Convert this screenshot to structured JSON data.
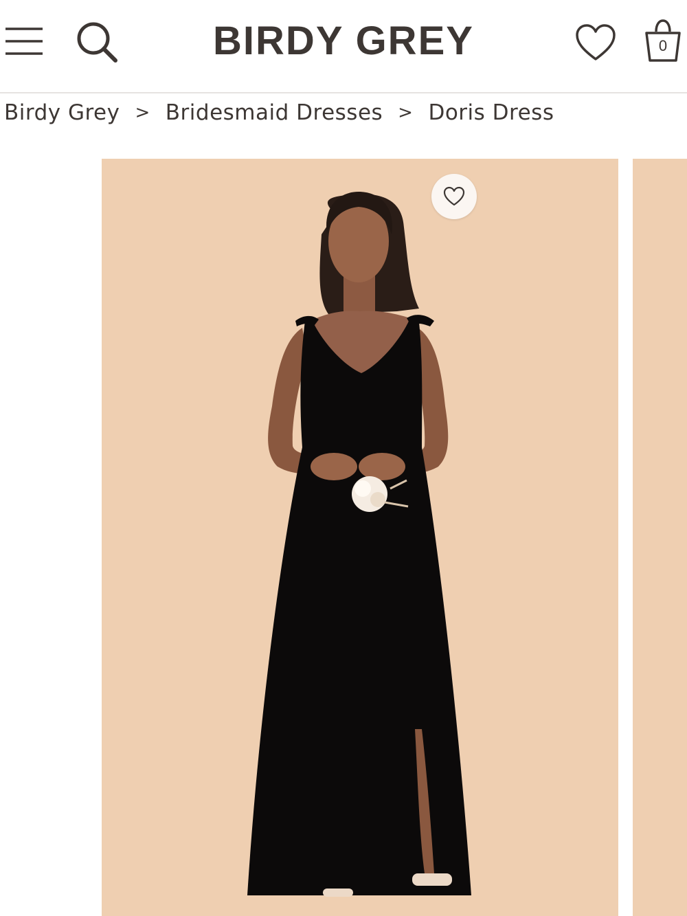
{
  "header": {
    "logo": "BIRDY GREY",
    "bag_count": "0",
    "icons": [
      "hamburger-menu-icon",
      "search-icon",
      "heart-icon",
      "shopping-bag-icon"
    ]
  },
  "breadcrumb": {
    "items": [
      "Birdy Grey",
      "Bridesmaid Dresses",
      "Doris Dress"
    ],
    "separator": ">"
  },
  "gallery": {
    "background_color": "#efcfb1",
    "dress_color": "#0c0a0a",
    "favorite_icon": "heart-outline-icon"
  }
}
